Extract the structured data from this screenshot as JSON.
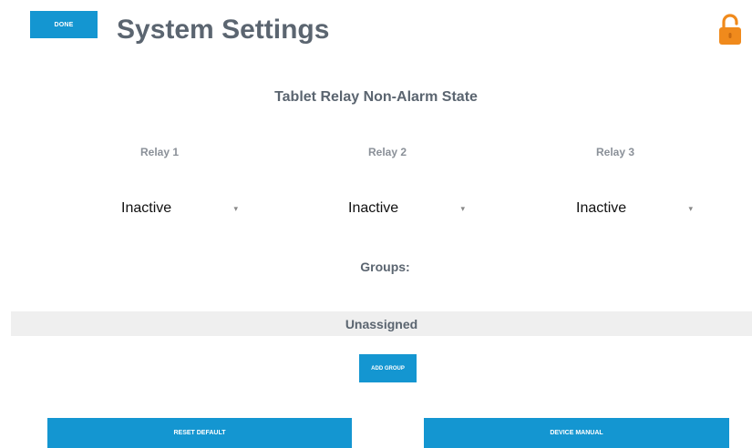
{
  "header": {
    "done_label": "DONE",
    "title": "System Settings",
    "lock_icon": "unlock-icon",
    "lock_color": "#f08a1c"
  },
  "relay_section": {
    "title": "Tablet Relay Non-Alarm State",
    "relays": [
      {
        "label": "Relay 1",
        "value": "Inactive"
      },
      {
        "label": "Relay 2",
        "value": "Inactive"
      },
      {
        "label": "Relay 3",
        "value": "Inactive"
      }
    ]
  },
  "groups": {
    "label": "Groups:",
    "unassigned_label": "Unassigned",
    "add_group_label": "ADD GROUP"
  },
  "footer": {
    "reset_label": "RESET DEFAULT",
    "manual_label": "DEVICE MANUAL"
  },
  "colors": {
    "accent": "#1496d1",
    "title_text": "#5b6570",
    "bar_bg": "#efefef"
  }
}
